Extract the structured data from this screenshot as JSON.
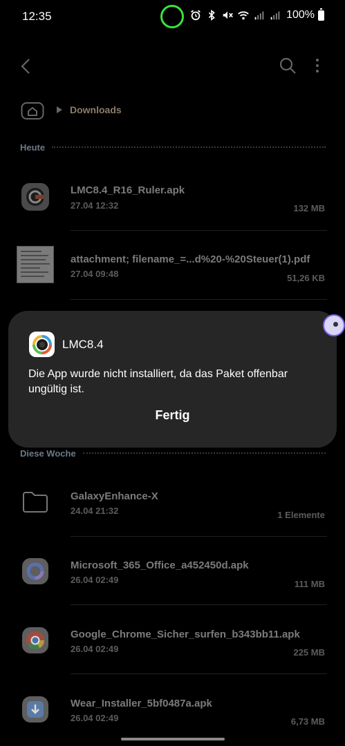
{
  "status_bar": {
    "time": "12:35",
    "battery": "100%",
    "icons": [
      "alarm-icon",
      "bluetooth-icon",
      "mute-icon",
      "wifi-icon",
      "signal-icon",
      "signal-icon",
      "battery-icon"
    ],
    "camera_ring_color": "#3ce23c"
  },
  "toolbar": {
    "back_icon": "chevron-left-icon",
    "search_icon": "search-icon",
    "more_icon": "more-vert-icon"
  },
  "breadcrumb": {
    "home_icon": "home-icon",
    "current": "Downloads"
  },
  "sections": [
    {
      "label": "Heute",
      "files": [
        {
          "name": "LMC8.4_R16_Ruler.apk",
          "date": "27.04 12:32",
          "size": "132 MB",
          "icon": "lmc-app-icon"
        },
        {
          "name": "attachment; filename_=...d%20-%20Steuer(1).pdf",
          "date": "27.04 09:48",
          "size": "51,26 KB",
          "icon": "pdf-thumbnail"
        }
      ]
    },
    {
      "label": "Diese Woche",
      "files": [
        {
          "name": "GalaxyEnhance-X",
          "date": "24.04 21:32",
          "size": "1 Elemente",
          "icon": "folder-icon"
        },
        {
          "name": "Microsoft_365_Office_a452450d.apk",
          "date": "26.04 02:49",
          "size": "111 MB",
          "icon": "office-app-icon"
        },
        {
          "name": "Google_Chrome_Sicher_surfen_b343bb11.apk",
          "date": "26.04 02:49",
          "size": "225 MB",
          "icon": "chrome-app-icon"
        },
        {
          "name": "Wear_Installer_5bf0487a.apk",
          "date": "26.04 02:49",
          "size": "6,73 MB",
          "icon": "download-app-icon"
        }
      ]
    }
  ],
  "dialog": {
    "app_icon": "lmc-app-icon",
    "title": "LMC8.4",
    "message": "Die App wurde nicht installiert, da das Paket offenbar ungültig ist.",
    "button": "Fertig"
  },
  "colors": {
    "background": "#000000",
    "dialog_bg": "#262626",
    "section_label": "#6c7a8a",
    "breadcrumb": "#8b7c6d"
  }
}
